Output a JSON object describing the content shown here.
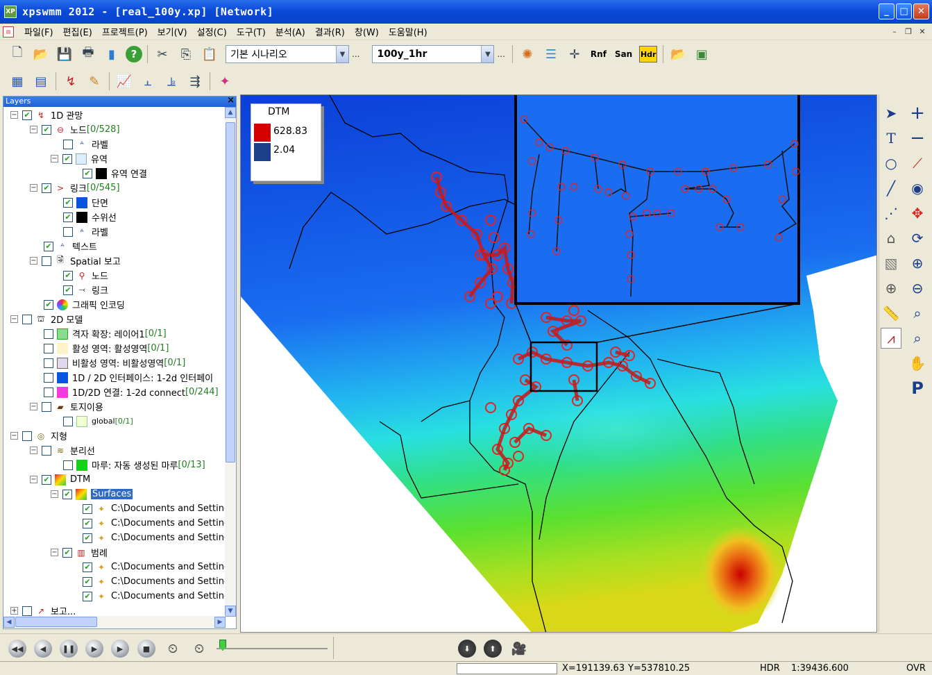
{
  "window": {
    "title": "xpswmm 2012 - [real_100y.xp] [Network]",
    "app_icon": "XP"
  },
  "menu": [
    "파일(F)",
    "편집(E)",
    "프로젝트(P)",
    "보기(V)",
    "설정(C)",
    "도구(T)",
    "분석(A)",
    "결과(R)",
    "창(W)",
    "도움말(H)"
  ],
  "toolbar": {
    "scenario_value": "기본 시나리오",
    "event_value": "100y_1hr",
    "dots": "...",
    "rnf": "Rnf",
    "san": "San",
    "hdr": "Hdr"
  },
  "layers": {
    "title": "Layers",
    "close": "×",
    "items": [
      {
        "label": "1D 관망"
      },
      {
        "label": "노드 ",
        "count": "[0/528]"
      },
      {
        "label": "라벨"
      },
      {
        "label": "유역"
      },
      {
        "label": "유역 연결"
      },
      {
        "label": "링크 ",
        "count": "[0/545]"
      },
      {
        "label": "단면"
      },
      {
        "label": "수위선"
      },
      {
        "label": "라벨"
      },
      {
        "label": "텍스트"
      },
      {
        "label": "Spatial 보고"
      },
      {
        "label": "노드"
      },
      {
        "label": "링크"
      },
      {
        "label": "그래픽 인코딩"
      },
      {
        "label": "2D 모델"
      },
      {
        "label": "격자 확장: 레이어1 ",
        "count": "[0/1]"
      },
      {
        "label": "활성 영역: 활성영역 ",
        "count": "[0/1]"
      },
      {
        "label": "비활성 영역: 비활성영역 ",
        "count": "[0/1]"
      },
      {
        "label": "1D / 2D 인터페이스: 1-2d 인터페이"
      },
      {
        "label": "1D/2D 연결: 1-2d connect ",
        "count": "[0/244]"
      },
      {
        "label": "토지이용"
      },
      {
        "label": "global ",
        "count": "[0/1]"
      },
      {
        "label": "지형"
      },
      {
        "label": "분리선"
      },
      {
        "label": "마루: 자동 생성된 마루 ",
        "count": "[0/13]"
      },
      {
        "label": "DTM"
      },
      {
        "label": "Surfaces"
      },
      {
        "label": "C:\\Documents and Setting"
      },
      {
        "label": "C:\\Documents and Setting"
      },
      {
        "label": "C:\\Documents and Setting"
      },
      {
        "label": "범례"
      },
      {
        "label": "C:\\Documents and Setting"
      },
      {
        "label": "C:\\Documents and Setting"
      },
      {
        "label": "C:\\Documents and Setting"
      },
      {
        "label": "보고..."
      }
    ]
  },
  "legend": {
    "title": "DTM",
    "max": "628.83",
    "min": "2.04",
    "max_color": "#d40000",
    "min_color": "#1c3f8c"
  },
  "palette": {
    "text_tool": "T",
    "pan_label": "P"
  },
  "status": {
    "x": "X=191139.63",
    "y": "Y=537810.25",
    "hdr": "HDR",
    "scale": "1:39436.600",
    "ovr": "OVR"
  }
}
